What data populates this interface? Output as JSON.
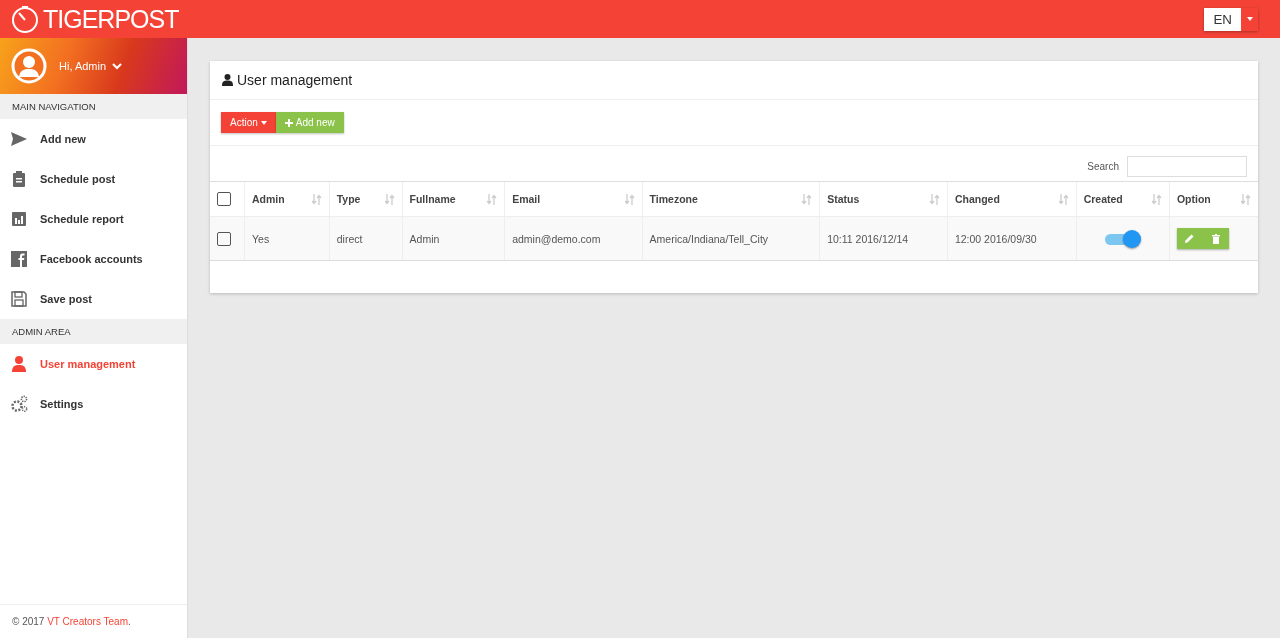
{
  "header": {
    "logo": "TIGERPOST",
    "language": "EN"
  },
  "user": {
    "greeting": "Hi, Admin"
  },
  "sidebar": {
    "sections": [
      {
        "title": "MAIN NAVIGATION",
        "items": [
          {
            "label": "Add new",
            "selected": false
          },
          {
            "label": "Schedule post",
            "selected": false
          },
          {
            "label": "Schedule report",
            "selected": false
          },
          {
            "label": "Facebook accounts",
            "selected": false
          },
          {
            "label": "Save post",
            "selected": false
          }
        ]
      },
      {
        "title": "ADMIN AREA",
        "items": [
          {
            "label": "User management",
            "selected": true
          },
          {
            "label": "Settings",
            "selected": false
          }
        ]
      }
    ],
    "footer": {
      "prefix": "© 2017",
      "link": "VT Creators Team",
      "suffix": "."
    }
  },
  "panel": {
    "title": "User management",
    "buttons": [
      {
        "label": "Action",
        "kind": "dropdown"
      },
      {
        "label": "Add new",
        "kind": "add"
      }
    ],
    "search": {
      "label": "Search"
    },
    "table": {
      "select_all": false,
      "columns": [
        "Admin",
        "Type",
        "Fullname",
        "Email",
        "Timezone",
        "Status",
        "Changed",
        "Created",
        "Option"
      ],
      "rows": [
        {
          "checked": false,
          "cells": [
            "Yes",
            "direct",
            "Admin",
            "admin@demo.com",
            "America/Indiana/Tell_City",
            "10:11 2016/12/14",
            "12:00 2016/09/30"
          ],
          "created": true
        }
      ]
    }
  }
}
